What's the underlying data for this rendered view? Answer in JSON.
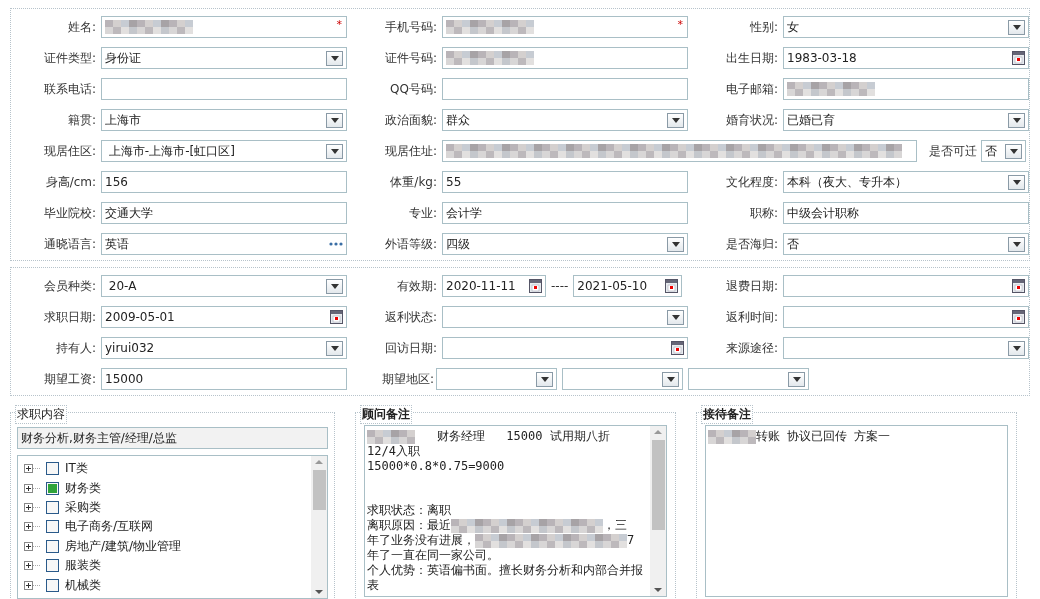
{
  "sections": [
    {
      "rows": [
        {
          "fields": [
            {
              "label": "姓名:",
              "kind": "text",
              "redacted": true,
              "required_mark": "*"
            },
            {
              "label": "手机号码:",
              "kind": "text",
              "redacted": true,
              "required_mark": "*"
            },
            {
              "label": "性别:",
              "kind": "select",
              "value": "女"
            }
          ]
        },
        {
          "fields": [
            {
              "label": "证件类型:",
              "kind": "select",
              "value": "身份证"
            },
            {
              "label": "证件号码:",
              "kind": "text",
              "redacted": true
            },
            {
              "label": "出生日期:",
              "kind": "date",
              "value": "1983-03-18"
            }
          ]
        },
        {
          "fields": [
            {
              "label": "联系电话:",
              "kind": "text"
            },
            {
              "label": "QQ号码:",
              "kind": "text"
            },
            {
              "label": "电子邮箱:",
              "kind": "text",
              "redacted": true
            }
          ]
        },
        {
          "fields": [
            {
              "label": "籍贯:",
              "kind": "select",
              "value": "上海市"
            },
            {
              "label": "政治面貌:",
              "kind": "select",
              "value": "群众"
            },
            {
              "label": "婚育状况:",
              "kind": "select",
              "value": "已婚已育"
            }
          ]
        },
        {
          "fields": [
            {
              "label": "现居住区:",
              "kind": "select",
              "value": " 上海市-上海市-[虹口区]"
            },
            {
              "label": "现居住址:",
              "kind": "address",
              "redacted": true
            },
            {
              "label": "是否可迁",
              "kind": "inline_select",
              "value": "否"
            }
          ]
        },
        {
          "fields": [
            {
              "label": "身高/cm:",
              "kind": "text",
              "value": "156"
            },
            {
              "label": "体重/kg:",
              "kind": "text",
              "value": "55"
            },
            {
              "label": "文化程度:",
              "kind": "select",
              "value": "本科（夜大、专升本）"
            }
          ]
        },
        {
          "fields": [
            {
              "label": "毕业院校:",
              "kind": "text",
              "value": "交通大学"
            },
            {
              "label": "专业:",
              "kind": "text",
              "value": "会计学"
            },
            {
              "label": "职称:",
              "kind": "text",
              "value": "中级会计职称"
            }
          ]
        },
        {
          "fields": [
            {
              "label": "通晓语言:",
              "kind": "picker",
              "value": "英语"
            },
            {
              "label": "外语等级:",
              "kind": "select",
              "value": "四级"
            },
            {
              "label": "是否海归:",
              "kind": "select",
              "value": "否"
            }
          ]
        }
      ]
    },
    {
      "rows": [
        {
          "fields": [
            {
              "label": "会员种类:",
              "kind": "select",
              "value": " 20-A"
            },
            {
              "label": "有效期:",
              "kind": "date_range",
              "values": [
                "2020-11-11",
                "2021-05-10"
              ],
              "separator": "----"
            },
            {
              "label": "退费日期:",
              "kind": "date"
            }
          ]
        },
        {
          "fields": [
            {
              "label": "求职日期:",
              "kind": "date",
              "value": "2009-05-01"
            },
            {
              "label": "返利状态:",
              "kind": "select"
            },
            {
              "label": "返利时间:",
              "kind": "date"
            }
          ]
        },
        {
          "fields": [
            {
              "label": "持有人:",
              "kind": "select",
              "value": "yirui032"
            },
            {
              "label": "回访日期:",
              "kind": "date"
            },
            {
              "label": "来源途径:",
              "kind": "select"
            }
          ]
        },
        {
          "fields": [
            {
              "label": "期望工资:",
              "kind": "text",
              "value": "15000"
            },
            {
              "label": "期望地区:",
              "kind": "multi_select",
              "selects": [
                {
                  "kind": "select"
                },
                {
                  "kind": "select"
                },
                {
                  "kind": "select"
                }
              ]
            }
          ]
        }
      ]
    }
  ],
  "job_content": {
    "legend": "求职内容",
    "summary": "财务分析,财务主管/经理/总监",
    "categories": [
      {
        "label": "IT类",
        "checked": false
      },
      {
        "label": "财务类",
        "checked": true
      },
      {
        "label": "采购类",
        "checked": false
      },
      {
        "label": "电子商务/互联网",
        "checked": false
      },
      {
        "label": "房地产/建筑/物业管理",
        "checked": false
      },
      {
        "label": "服装类",
        "checked": false
      },
      {
        "label": "机械类",
        "checked": false
      }
    ]
  },
  "notes": [
    {
      "legend": "顾问备注",
      "lines": [
        {
          "parts": [
            {
              "kind": "redacted"
            },
            {
              "kind": "text",
              "text": "   财务经理   15000 试用期八折"
            }
          ]
        },
        {
          "parts": [
            {
              "kind": "text",
              "text": "12/4入职"
            }
          ]
        },
        {
          "parts": [
            {
              "kind": "text",
              "text": "15000*0.8*0.75=9000"
            }
          ]
        },
        {
          "kind": "blank"
        },
        {
          "kind": "blank"
        },
        {
          "parts": [
            {
              "kind": "text",
              "text": "求职状态：离职"
            }
          ]
        },
        {
          "parts": [
            {
              "kind": "text",
              "text": "离职原因：最近"
            },
            {
              "kind": "redacted"
            },
            {
              "kind": "text",
              "text": "，三"
            }
          ]
        },
        {
          "parts": [
            {
              "kind": "text",
              "text": "年了业务没有进展，"
            },
            {
              "kind": "redacted"
            },
            {
              "kind": "text",
              "text": "7"
            }
          ]
        },
        {
          "parts": [
            {
              "kind": "text",
              "text": "年了一直在同一家公司。"
            }
          ]
        },
        {
          "parts": [
            {
              "kind": "text",
              "text": "个人优势：英语偏书面。擅长财务分析和内部合并报"
            }
          ]
        },
        {
          "parts": [
            {
              "kind": "text",
              "text": "表"
            }
          ]
        }
      ],
      "scrollbar": true
    },
    {
      "legend": "接待备注",
      "lines": [
        {
          "parts": [
            {
              "kind": "redacted"
            },
            {
              "kind": "text",
              "text": "转账 协议已回传 方案一"
            }
          ]
        }
      ],
      "scrollbar": false
    }
  ]
}
